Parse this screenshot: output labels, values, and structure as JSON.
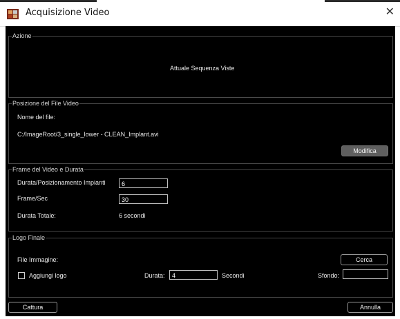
{
  "window": {
    "title": "Acquisizione Video",
    "close_glyph": "✕"
  },
  "azione": {
    "legend": "Azione",
    "status_text": "Attuale Sequenza Viste"
  },
  "posizione": {
    "legend": "Posizione del File Video",
    "file_name_label": "Nome del file:",
    "file_path": "C:/ImageRoot/3_single_lower - CLEAN_Implant.avi",
    "modify_button": "Modifica"
  },
  "frame": {
    "legend": "Frame del Video e Durata",
    "duration_label": "Durata/Posizionamento Impianti",
    "duration_value": "6",
    "fps_label": "Frame/Sec",
    "fps_value": "30",
    "total_label": "Durata Totale:",
    "total_value": "6 secondi"
  },
  "logo": {
    "legend": "Logo Finale",
    "image_file_label": "File Immagine:",
    "search_button": "Cerca",
    "add_logo_label": "Aggiungi logo",
    "add_logo_checked": false,
    "duration_label": "Durata:",
    "duration_value": "4",
    "seconds_label": "Secondi",
    "background_label": "Sfondo:",
    "background_value": ""
  },
  "footer": {
    "capture_button": "Cattura",
    "cancel_button": "Annulla"
  }
}
